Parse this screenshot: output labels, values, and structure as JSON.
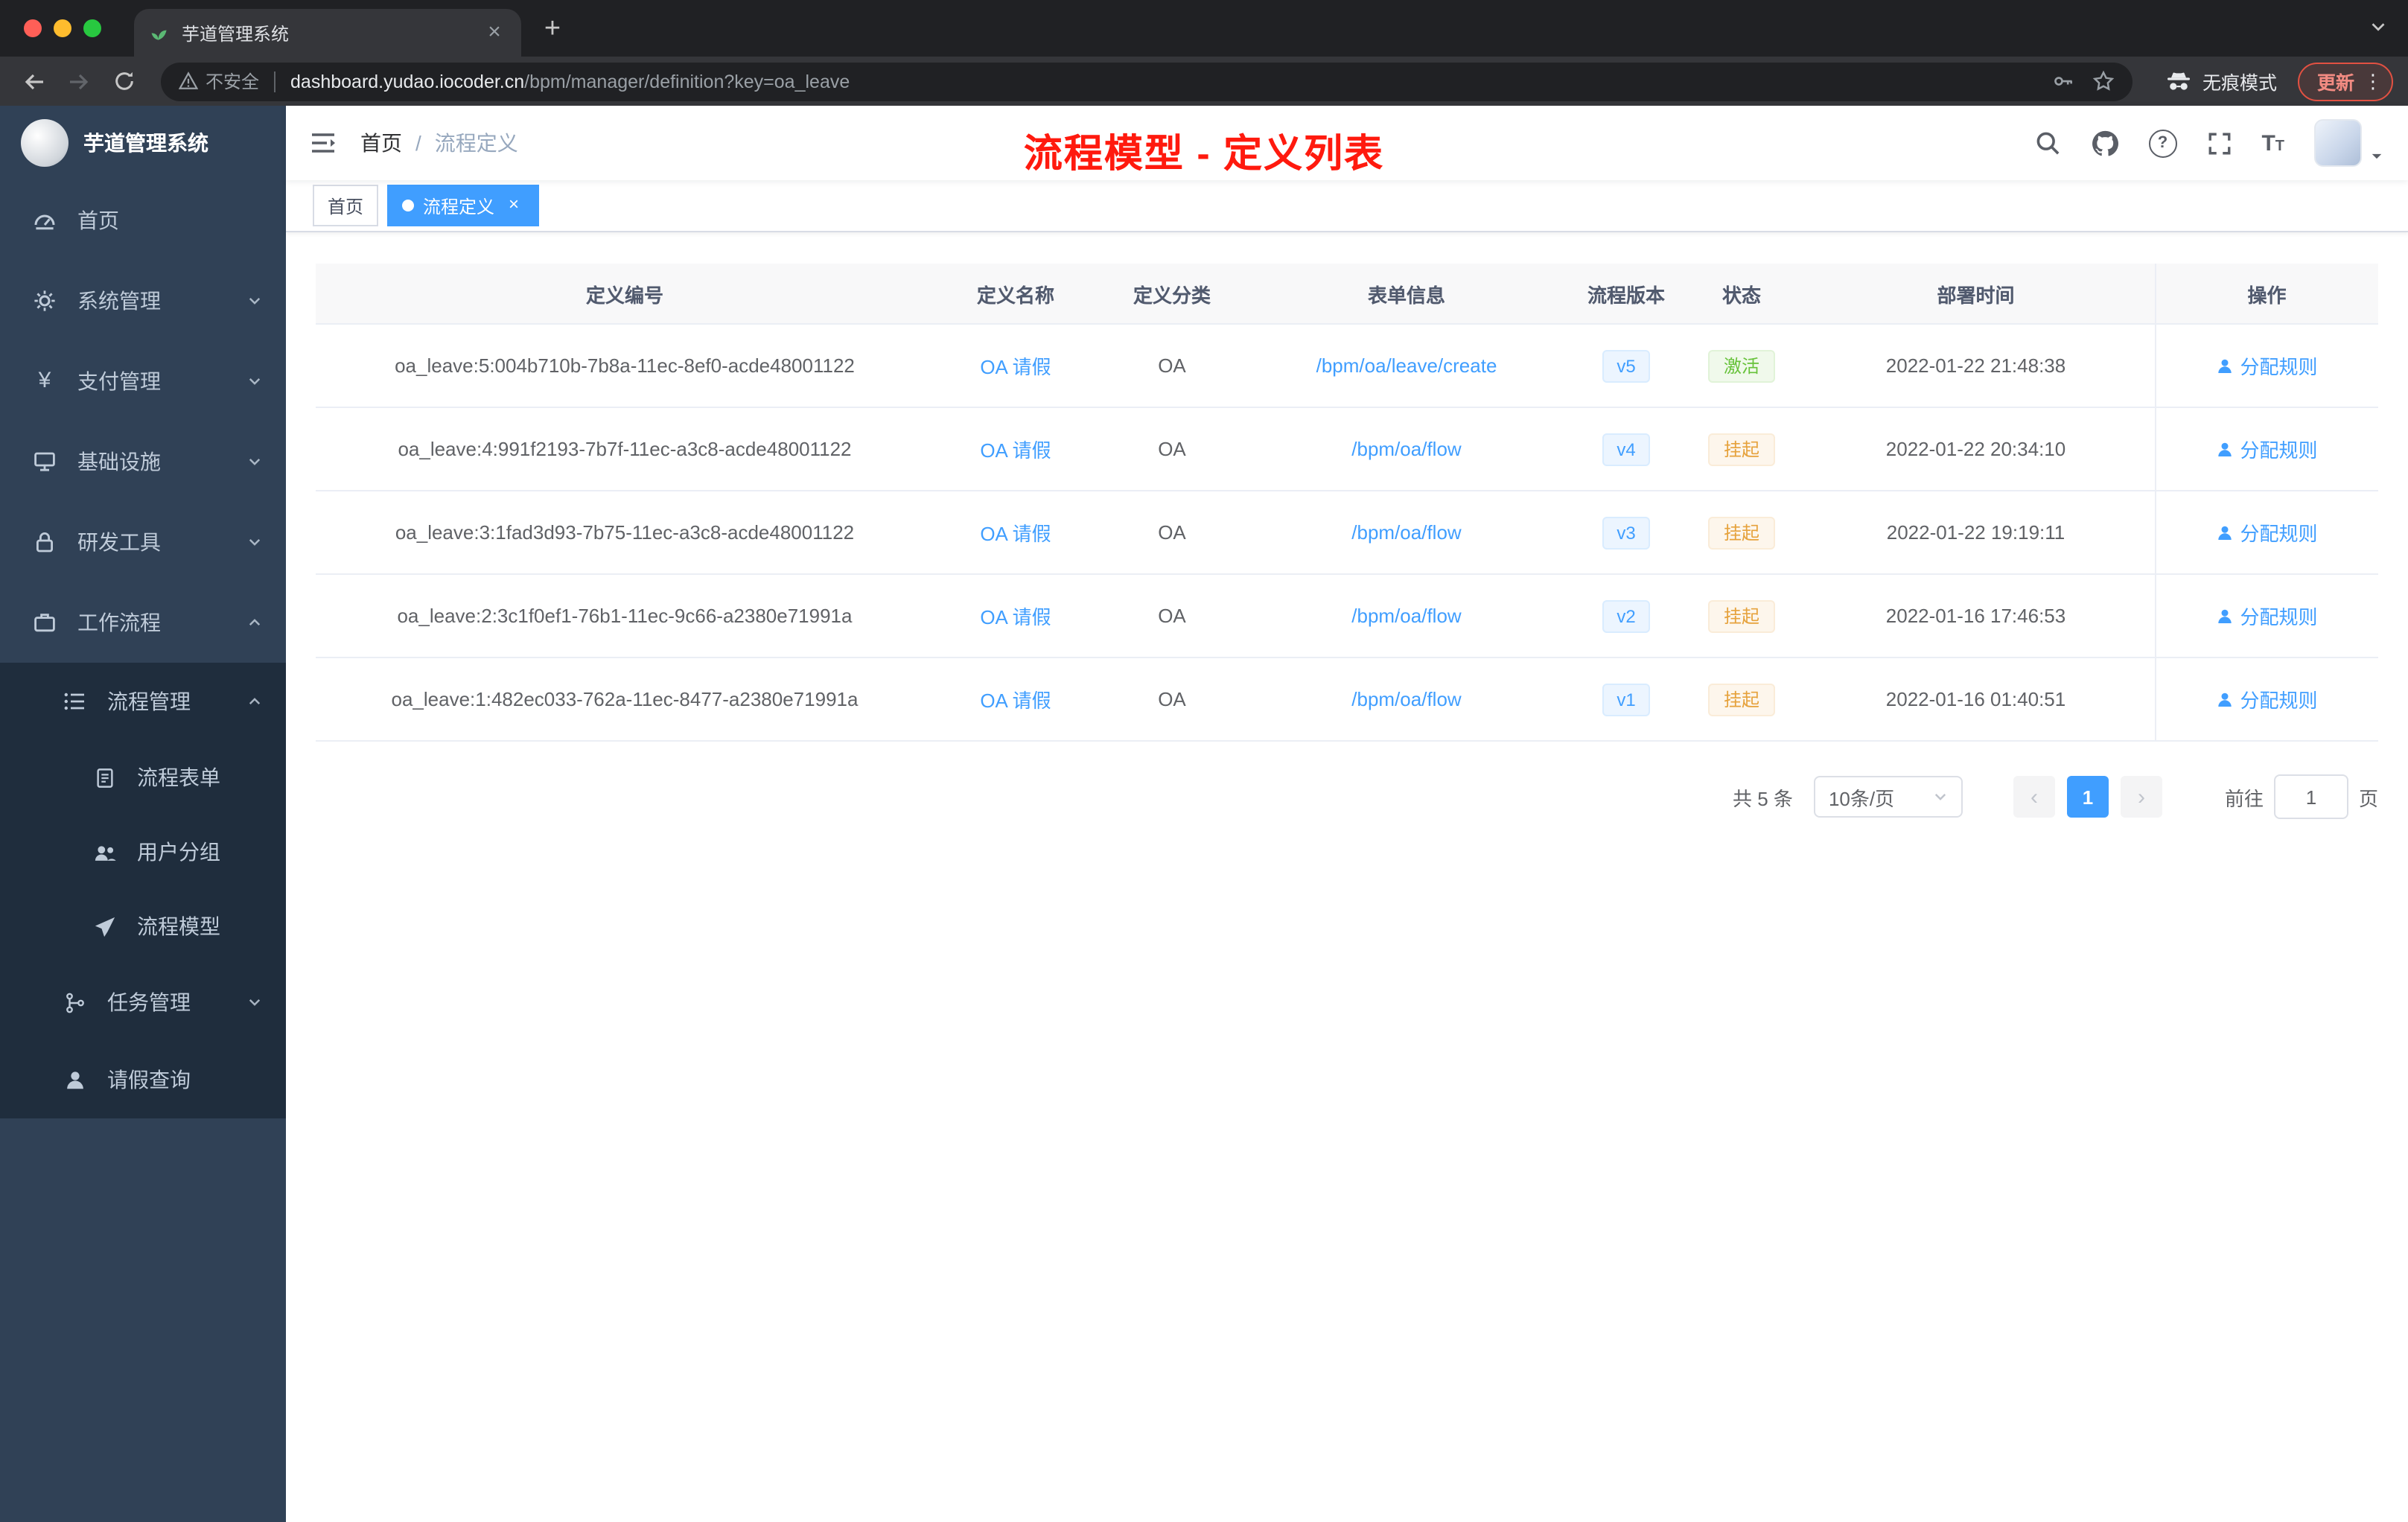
{
  "browser": {
    "tab_title": "芋道管理系统",
    "security_label": "不安全",
    "url_host": "dashboard.yudao.iocoder.cn",
    "url_path": "/bpm/manager/definition?key=oa_leave",
    "incognito_label": "无痕模式",
    "update_label": "更新"
  },
  "sidebar": {
    "logo_title": "芋道管理系统",
    "items": [
      {
        "label": "首页"
      },
      {
        "label": "系统管理"
      },
      {
        "label": "支付管理"
      },
      {
        "label": "基础设施"
      },
      {
        "label": "研发工具"
      },
      {
        "label": "工作流程"
      },
      {
        "label": "流程管理"
      },
      {
        "label": "流程表单"
      },
      {
        "label": "用户分组"
      },
      {
        "label": "流程模型"
      },
      {
        "label": "任务管理"
      },
      {
        "label": "请假查询"
      }
    ]
  },
  "header": {
    "breadcrumb": [
      "首页",
      "流程定义"
    ],
    "overlay_title": "流程模型 - 定义列表"
  },
  "tags": [
    {
      "label": "首页"
    },
    {
      "label": "流程定义"
    }
  ],
  "table": {
    "columns": [
      "定义编号",
      "定义名称",
      "定义分类",
      "表单信息",
      "流程版本",
      "状态",
      "部署时间",
      "操作"
    ],
    "rows": [
      {
        "id": "oa_leave:5:004b710b-7b8a-11ec-8ef0-acde48001122",
        "name": "OA 请假",
        "category": "OA",
        "form": "/bpm/oa/leave/create",
        "version": "v5",
        "status": "激活",
        "time": "2022-01-22 21:48:38",
        "action": "分配规则"
      },
      {
        "id": "oa_leave:4:991f2193-7b7f-11ec-a3c8-acde48001122",
        "name": "OA 请假",
        "category": "OA",
        "form": "/bpm/oa/flow",
        "version": "v4",
        "status": "挂起",
        "time": "2022-01-22 20:34:10",
        "action": "分配规则"
      },
      {
        "id": "oa_leave:3:1fad3d93-7b75-11ec-a3c8-acde48001122",
        "name": "OA 请假",
        "category": "OA",
        "form": "/bpm/oa/flow",
        "version": "v3",
        "status": "挂起",
        "time": "2022-01-22 19:19:11",
        "action": "分配规则"
      },
      {
        "id": "oa_leave:2:3c1f0ef1-76b1-11ec-9c66-a2380e71991a",
        "name": "OA 请假",
        "category": "OA",
        "form": "/bpm/oa/flow",
        "version": "v2",
        "status": "挂起",
        "time": "2022-01-16 17:46:53",
        "action": "分配规则"
      },
      {
        "id": "oa_leave:1:482ec033-762a-11ec-8477-a2380e71991a",
        "name": "OA 请假",
        "category": "OA",
        "form": "/bpm/oa/flow",
        "version": "v1",
        "status": "挂起",
        "time": "2022-01-16 01:40:51",
        "action": "分配规则"
      }
    ]
  },
  "pagination": {
    "total": "共 5 条",
    "page_size": "10条/页",
    "current_page": "1",
    "goto_prefix": "前往",
    "goto_value": "1",
    "goto_suffix": "页"
  },
  "colors": {
    "accent": "#409eff",
    "success": "#67c23a",
    "warning": "#e6a23c",
    "annotation_red": "#ff1a0e",
    "sidebar_bg": "#304156",
    "submenu_bg": "#1f2d3d"
  }
}
